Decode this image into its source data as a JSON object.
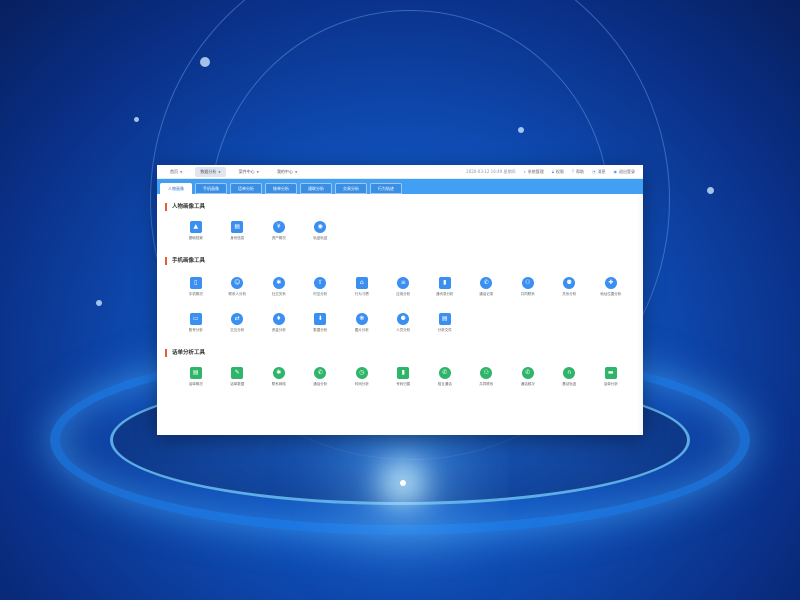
{
  "topbar": {
    "nav": [
      {
        "label": "首页",
        "active": false
      },
      {
        "label": "数据分析",
        "active": true
      },
      {
        "label": "案件中心",
        "active": false
      },
      {
        "label": "我的中心",
        "active": false
      }
    ],
    "datetime": "2020-03-12 16:49 星期四",
    "links": [
      {
        "label": "系统管理",
        "icon": "search-icon"
      },
      {
        "label": "权限",
        "icon": "lock-icon"
      },
      {
        "label": "帮助",
        "icon": "help-icon"
      },
      {
        "label": "消息",
        "icon": "bell-icon"
      },
      {
        "label": "退出登录",
        "icon": "user-icon"
      }
    ]
  },
  "tabs": [
    {
      "label": "人物画像",
      "active": true
    },
    {
      "label": "手机画像",
      "active": false
    },
    {
      "label": "话单分析",
      "active": false
    },
    {
      "label": "账单分析",
      "active": false
    },
    {
      "label": "通联分析",
      "active": false
    },
    {
      "label": "交易分析",
      "active": false
    },
    {
      "label": "行为轨迹",
      "active": false
    }
  ],
  "sections": [
    {
      "title": "人物画像工具",
      "rows": [
        [
          {
            "label": "基础档案",
            "icon": "person-card-icon",
            "glyph": "▲",
            "color": "blue",
            "square": true
          },
          {
            "label": "身份信息",
            "icon": "id-card-icon",
            "glyph": "▤",
            "color": "blue",
            "square": true
          },
          {
            "label": "资产概况",
            "icon": "money-icon",
            "glyph": "¥",
            "color": "blue",
            "square": false
          },
          {
            "label": "轨迹轨迹",
            "icon": "location-icon",
            "glyph": "◉",
            "color": "blue",
            "square": false
          }
        ]
      ]
    },
    {
      "title": "手机画像工具",
      "rows": [
        [
          {
            "label": "手机概况",
            "icon": "phone-icon",
            "glyph": "▯",
            "color": "blue",
            "square": true
          },
          {
            "label": "联系人分析",
            "icon": "contact-icon",
            "glyph": "☺",
            "color": "blue",
            "square": false
          },
          {
            "label": "社交关系",
            "icon": "network-icon",
            "glyph": "✱",
            "color": "blue",
            "square": false
          },
          {
            "label": "时空分析",
            "icon": "rocket-icon",
            "glyph": "⇧",
            "color": "blue",
            "square": false
          },
          {
            "label": "行为习惯",
            "icon": "home-icon",
            "glyph": "⌂",
            "color": "blue",
            "square": true
          },
          {
            "label": "应用分析",
            "icon": "database-icon",
            "glyph": "≡",
            "color": "blue",
            "square": false
          },
          {
            "label": "通讯录分析",
            "icon": "address-book-icon",
            "glyph": "▮",
            "color": "blue",
            "square": true
          },
          {
            "label": "通话记录",
            "icon": "call-icon",
            "glyph": "✆",
            "color": "blue",
            "square": false
          },
          {
            "label": "共同联系",
            "icon": "users-icon",
            "glyph": "⚇",
            "color": "blue",
            "square": false
          },
          {
            "label": "关系分析",
            "icon": "team-icon",
            "glyph": "⚉",
            "color": "blue",
            "square": false
          },
          {
            "label": "地址位置分析",
            "icon": "map-pin-icon",
            "glyph": "✚",
            "color": "blue",
            "square": false
          }
        ],
        [
          {
            "label": "账号分析",
            "icon": "account-icon",
            "glyph": "▭",
            "color": "blue",
            "square": true
          },
          {
            "label": "交互分析",
            "icon": "exchange-icon",
            "glyph": "⇄",
            "color": "blue",
            "square": false
          },
          {
            "label": "资金分析",
            "icon": "hand-money-icon",
            "glyph": "♦",
            "color": "blue",
            "square": false
          },
          {
            "label": "数据分析",
            "icon": "download-icon",
            "glyph": "⬇",
            "color": "blue",
            "square": true
          },
          {
            "label": "图片分析",
            "icon": "aperture-icon",
            "glyph": "❋",
            "color": "blue",
            "square": false
          },
          {
            "label": "人员分析",
            "icon": "group-icon",
            "glyph": "⚈",
            "color": "blue",
            "square": false
          },
          {
            "label": "分析文件",
            "icon": "file-icon",
            "glyph": "▤",
            "color": "blue",
            "square": true
          }
        ]
      ]
    },
    {
      "title": "话单分析工具",
      "rows": [
        [
          {
            "label": "话单概况",
            "icon": "doc-check-icon",
            "glyph": "▤",
            "color": "green",
            "square": true
          },
          {
            "label": "话单数据",
            "icon": "doc-edit-icon",
            "glyph": "✎",
            "color": "green",
            "square": true
          },
          {
            "label": "联系网络",
            "icon": "network-icon",
            "glyph": "✱",
            "color": "green",
            "square": false
          },
          {
            "label": "通话分析",
            "icon": "call-icon",
            "glyph": "✆",
            "color": "green",
            "square": false
          },
          {
            "label": "时间分析",
            "icon": "clock-icon",
            "glyph": "◷",
            "color": "green",
            "square": false
          },
          {
            "label": "号码归属",
            "icon": "address-book-icon",
            "glyph": "▮",
            "color": "green",
            "square": true
          },
          {
            "label": "相互通话",
            "icon": "call-forward-icon",
            "glyph": "✆",
            "color": "green",
            "square": false
          },
          {
            "label": "共同联系",
            "icon": "users-icon",
            "glyph": "⚇",
            "color": "green",
            "square": false
          },
          {
            "label": "通话频次",
            "icon": "chat-phone-icon",
            "glyph": "✆",
            "color": "green",
            "square": false
          },
          {
            "label": "基站轨迹",
            "icon": "headset-icon",
            "glyph": "∩",
            "color": "green",
            "square": false
          },
          {
            "label": "话单分析",
            "icon": "car-icon",
            "glyph": "▬",
            "color": "green",
            "square": true
          }
        ]
      ]
    }
  ]
}
